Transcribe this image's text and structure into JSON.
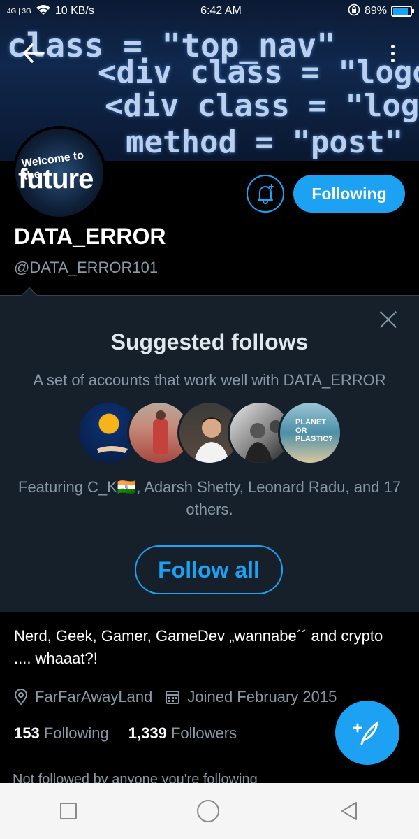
{
  "status_bar": {
    "network": "4G | 3G",
    "speed": "10 KB/s",
    "time": "6:42 AM",
    "battery": "89%",
    "battery_level": 0.89
  },
  "banner": {
    "code_lines": [
      "class = \"top_nav\"",
      "<div class = \"logo\"",
      "<div class = \"log",
      "method = \"post\""
    ]
  },
  "profile": {
    "avatar_text_1": "Welcome to the",
    "avatar_text_2": "future",
    "follow_button": "Following",
    "display_name": "DATA_ERROR",
    "handle": "@DATA_ERROR101"
  },
  "suggested": {
    "title": "Suggested follows",
    "subtitle": "A set of accounts that work well with DATA_ERROR",
    "featuring": "Featuring C_K🇮🇳, Adarsh Shetty, Leonard Radu, and 17 others.",
    "follow_all": "Follow all",
    "avatar_5_text": "PLANET OR PLASTIC?"
  },
  "bio": {
    "text": "Nerd, Geek, Gamer, GameDev „wannabe´´ and crypto .... whaaat?!",
    "location": "FarFarAwayLand",
    "joined": "Joined February 2015",
    "following_count": "153",
    "following_label": "Following",
    "followers_count": "1,339",
    "followers_label": "Followers",
    "not_followed": "Not followed by anyone you're following"
  },
  "colors": {
    "accent": "#1da1f2",
    "panel": "#15202b",
    "muted": "#8899a6"
  }
}
